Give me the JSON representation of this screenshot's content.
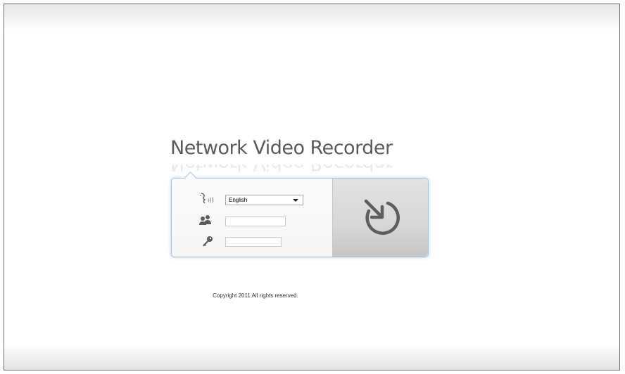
{
  "app": {
    "title": "Network Video Recorder"
  },
  "login": {
    "language": {
      "selected": "English",
      "icon": "language-icon"
    },
    "username": {
      "value": "",
      "icon": "users-icon"
    },
    "password": {
      "value": "",
      "icon": "key-icon"
    },
    "submit_icon": "login-arrow-icon"
  },
  "footer": {
    "copyright": "Copyright 2011 All rights reserved."
  },
  "colors": {
    "border": "#a9c6dc",
    "title": "#5a5a5a",
    "button": "#d7d7d7"
  }
}
